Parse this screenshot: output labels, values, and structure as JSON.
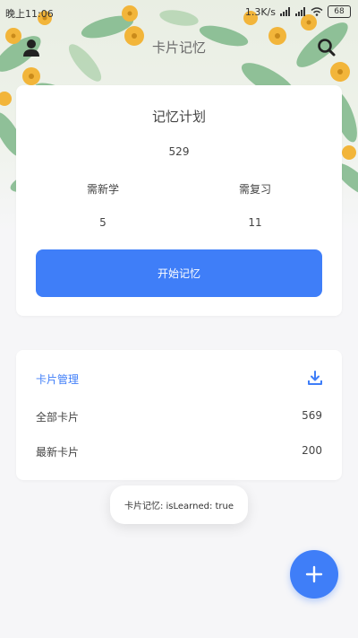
{
  "status_bar": {
    "time": "晚上11:06",
    "network_speed": "1.3K/s",
    "battery": "68"
  },
  "app_bar": {
    "title": "卡片记忆",
    "left_icon": "profile-icon",
    "right_icon": "search-icon"
  },
  "plan": {
    "title": "记忆计划",
    "total": "529",
    "new_label": "需新学",
    "review_label": "需复习",
    "new_count": "5",
    "review_count": "11",
    "start_button": "开始记忆"
  },
  "manage": {
    "title": "卡片管理",
    "download_icon": "download-icon",
    "rows": [
      {
        "label": "全部卡片",
        "value": "569"
      },
      {
        "label": "最新卡片",
        "value": "200"
      }
    ]
  },
  "toast": "卡片记忆: isLearned: true",
  "fab": {
    "icon": "plus-icon"
  },
  "colors": {
    "accent": "#3f7ef8",
    "background": "#f6f6f8",
    "card": "#ffffff"
  }
}
